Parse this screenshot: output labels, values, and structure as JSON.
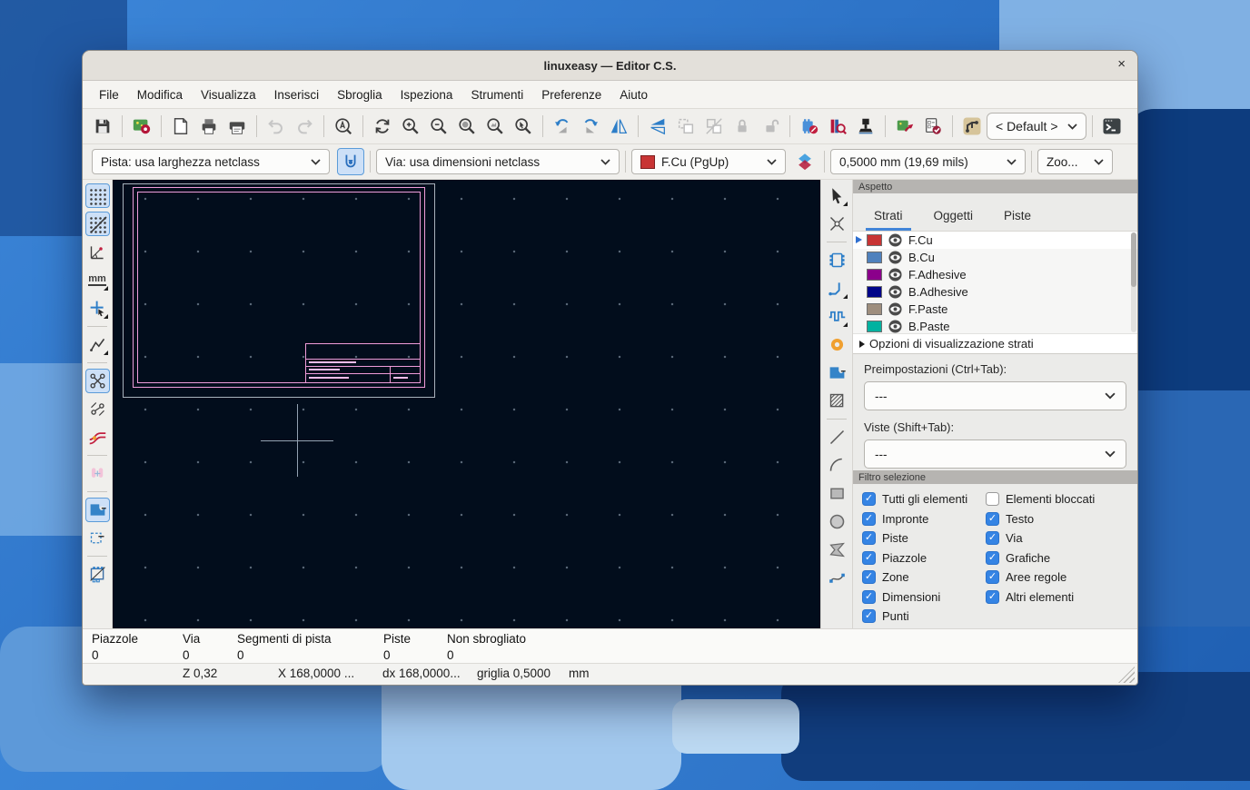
{
  "window": {
    "title": "linuxeasy — Editor C.S.",
    "close_glyph": "×"
  },
  "menu": {
    "items": [
      "File",
      "Modifica",
      "Visualizza",
      "Inserisci",
      "Sbroglia",
      "Ispeziona",
      "Strumenti",
      "Preferenze",
      "Aiuto"
    ]
  },
  "toolbar": {
    "netclass_dropdown": "< Default >"
  },
  "toolbar2": {
    "track_width": "Pista: usa larghezza netclass",
    "via_size": "Via: usa dimensioni netclass",
    "layer": "F.Cu (PgUp)",
    "layer_color": "#c83434",
    "grid": "0,5000 mm (19,69 mils)",
    "zoom": "Zoo...",
    "units_label": "mm"
  },
  "aspetto": {
    "header": "Aspetto",
    "tabs": [
      "Strati",
      "Oggetti",
      "Piste"
    ],
    "active_tab": "Strati",
    "layers": [
      {
        "name": "F.Cu",
        "color": "#c83434",
        "selected": true
      },
      {
        "name": "B.Cu",
        "color": "#4f81bd",
        "selected": false
      },
      {
        "name": "F.Adhesive",
        "color": "#8b008b",
        "selected": false
      },
      {
        "name": "B.Adhesive",
        "color": "#000589",
        "selected": false
      },
      {
        "name": "F.Paste",
        "color": "#9e8e7e",
        "selected": false
      },
      {
        "name": "B.Paste",
        "color": "#00b2a0",
        "selected": false
      }
    ],
    "options_row": "Opzioni di visualizzazione strati",
    "presets_label": "Preimpostazioni (Ctrl+Tab):",
    "presets_value": "---",
    "views_label": "Viste (Shift+Tab):",
    "views_value": "---"
  },
  "filter": {
    "header": "Filtro selezione",
    "items": [
      {
        "label": "Tutti gli elementi",
        "checked": true
      },
      {
        "label": "Elementi bloccati",
        "checked": false
      },
      {
        "label": "Impronte",
        "checked": true
      },
      {
        "label": "Testo",
        "checked": true
      },
      {
        "label": "Piste",
        "checked": true
      },
      {
        "label": "Via",
        "checked": true
      },
      {
        "label": "Piazzole",
        "checked": true
      },
      {
        "label": "Grafiche",
        "checked": true
      },
      {
        "label": "Zone",
        "checked": true
      },
      {
        "label": "Aree regole",
        "checked": true
      },
      {
        "label": "Dimensioni",
        "checked": true
      },
      {
        "label": "Altri elementi",
        "checked": true
      },
      {
        "label": "Punti",
        "checked": true
      }
    ]
  },
  "status": {
    "cells": [
      {
        "label": "Piazzole",
        "value": "0"
      },
      {
        "label": "Via",
        "value": "0"
      },
      {
        "label": "Segmenti di pista",
        "value": "0"
      },
      {
        "label": "Piste",
        "value": "0"
      },
      {
        "label": "Non sbrogliato",
        "value": "0"
      }
    ],
    "coords": {
      "zoom": "Z 0,32",
      "x": "X 168,0000  ...",
      "dx": "dx 168,0000...",
      "grid": "griglia 0,5000",
      "units": "mm"
    }
  }
}
